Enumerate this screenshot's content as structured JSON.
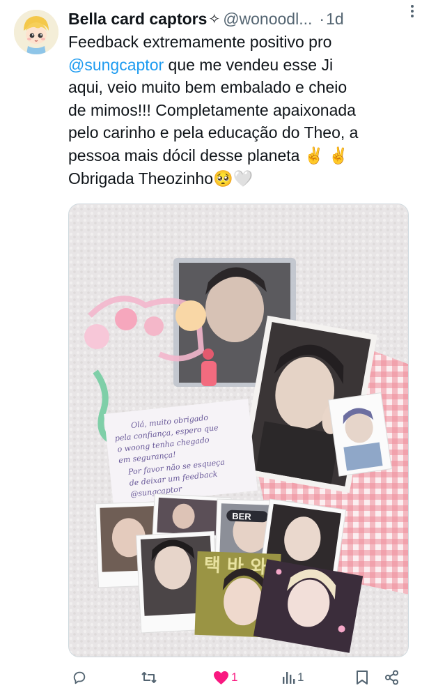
{
  "author": {
    "display_name": "Bella card captors",
    "name_glyph": "✧",
    "handle": "@wonoodl...",
    "separator": "·",
    "time": "1d"
  },
  "tweet": {
    "lines": [
      {
        "text": "Feedback extremamente positivo pro"
      },
      {
        "mention": "@sungcaptor",
        "text": " que me vendeu esse Ji"
      },
      {
        "text": "aqui, veio muito bem embalado e cheio"
      },
      {
        "text": "de mimos!!! Completamente apaixonada"
      },
      {
        "text": "pelo carinho e pela educação do Theo, a"
      },
      {
        "text": "pessoa mais dócil desse planeta ✌️ ✌️"
      },
      {
        "text": "Obrigada Theozinho🥺🤍"
      }
    ]
  },
  "media": {
    "note_lines": [
      "Olá, muito obrigado",
      "pela confiança, espero que",
      "o woong tenha chegado",
      "em segurança!",
      "Por favor não se esqueça",
      "de deixar um feedback",
      "@sungcaptor"
    ],
    "banner_text": "BER",
    "sticker_text": "택 바 와"
  },
  "actions": {
    "reply_count": "",
    "retweet_count": "",
    "like_count": "1",
    "views_count": "1"
  },
  "colors": {
    "text": "#0f1419",
    "secondary": "#536471",
    "link": "#1d9bf0",
    "like": "#f91880"
  },
  "icons": [
    "more-icon",
    "reply-icon",
    "retweet-icon",
    "heart-filled-icon",
    "views-icon",
    "bookmark-icon",
    "share-icon"
  ]
}
